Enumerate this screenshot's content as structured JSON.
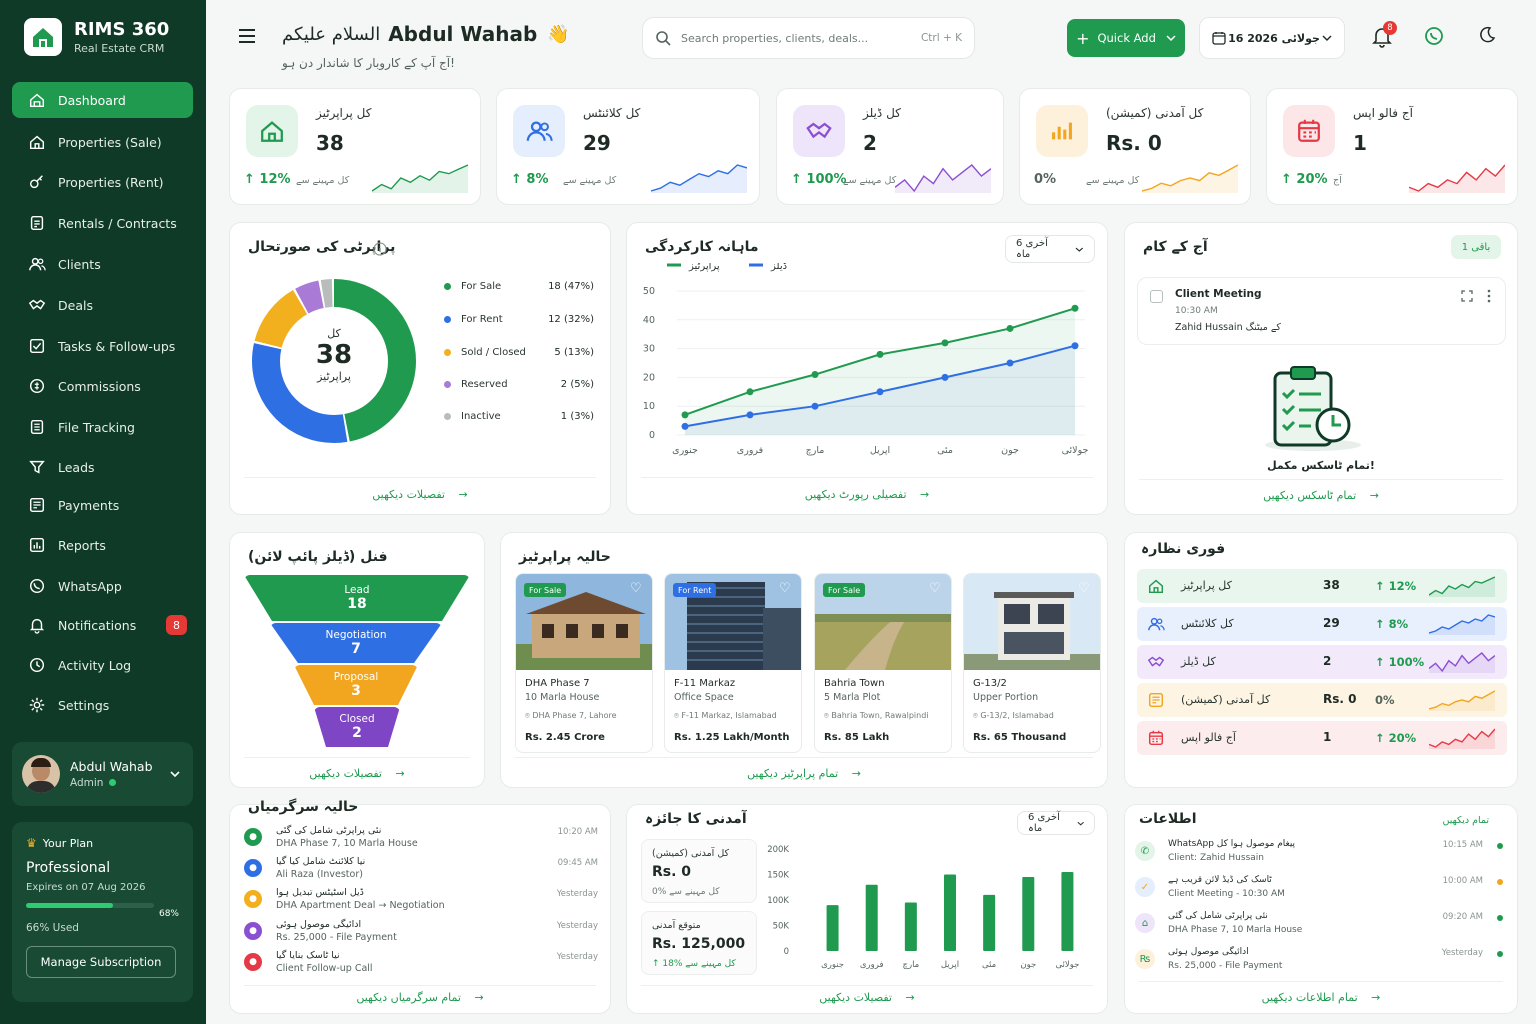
{
  "brand": {
    "name": "RIMS 360",
    "subtitle": "Real Estate CRM"
  },
  "nav": [
    {
      "label": "Dashboard",
      "icon": "dashboard-icon",
      "active": true
    },
    {
      "label": "Properties (Sale)",
      "icon": "home-icon"
    },
    {
      "label": "Properties (Rent)",
      "icon": "key-icon"
    },
    {
      "label": "Rentals / Contracts",
      "icon": "contract-icon"
    },
    {
      "label": "Clients",
      "icon": "users-icon"
    },
    {
      "label": "Deals",
      "icon": "handshake-icon"
    },
    {
      "label": "Tasks & Follow-ups",
      "icon": "checklist-icon"
    },
    {
      "label": "Commissions",
      "icon": "coin-icon"
    },
    {
      "label": "File Tracking",
      "icon": "file-icon"
    },
    {
      "label": "Leads",
      "icon": "funnel-icon"
    },
    {
      "label": "Payments",
      "icon": "payment-icon"
    },
    {
      "label": "Reports",
      "icon": "report-icon"
    },
    {
      "label": "WhatsApp",
      "icon": "whatsapp-icon"
    },
    {
      "label": "Notifications",
      "icon": "bell-icon",
      "badge": "8"
    },
    {
      "label": "Activity Log",
      "icon": "clock-icon"
    },
    {
      "label": "Settings",
      "icon": "gear-icon"
    }
  ],
  "user": {
    "name": "Abdul Wahab",
    "role": "Admin"
  },
  "plan": {
    "title": "Your Plan",
    "name": "Professional",
    "expires": "Expires on 07 Aug 2026",
    "percent_label": "68%",
    "used_fraction": 0.68,
    "used": "66% Used",
    "button": "Manage Subscription"
  },
  "header": {
    "salaam": "السلام علیکم",
    "name": "Abdul Wahab",
    "wave": "👋",
    "subtitle": "آج آپ کے کاروبار کا شاندار دن ہو!",
    "search_placeholder": "Search properties, clients, deals...",
    "search_shortcut": "Ctrl + K",
    "quick_add": "Quick Add",
    "date": "16 جولائی 2026",
    "bell_badge": "8"
  },
  "stats": [
    {
      "label": "کل پراپرٹیز",
      "value": "38",
      "trend": "↑ 12%",
      "sub": "کل مہینے سے",
      "color": "#1f9a4f",
      "bg": "#e3f4e9",
      "icon": "home-icon"
    },
    {
      "label": "کل کلائنٹس",
      "value": "29",
      "trend": "↑ 8%",
      "sub": "کل مہینے سے",
      "color": "#2f6fe4",
      "bg": "#e5eefc",
      "icon": "users-icon"
    },
    {
      "label": "کل ڈیلز",
      "value": "2",
      "trend": "↑ 100%",
      "sub": "کل مہینے سے",
      "color": "#8b4fd1",
      "bg": "#efe5fa",
      "icon": "handshake-icon"
    },
    {
      "label": "کل آمدنی (کمیشن)",
      "value": "Rs. 0",
      "trend": "0%",
      "sub": "کل مہینے سے",
      "color": "#f2a51e",
      "bg": "#fdf1dc",
      "icon": "chart-icon"
    },
    {
      "label": "آج فالو اپس",
      "value": "1",
      "trend": "↑ 20%",
      "sub": "آج",
      "color": "#e53945",
      "bg": "#fde6e8",
      "icon": "calendar-icon"
    }
  ],
  "status": {
    "title": "پراپرٹی کی صورتحال",
    "center_top": "کل",
    "center_value": "38",
    "center_bottom": "پراپرٹیز",
    "legend": [
      {
        "label": "For Sale",
        "value": "18 (47%)",
        "count": 18,
        "color": "#1f9a4f"
      },
      {
        "label": "For Rent",
        "value": "12 (32%)",
        "count": 12,
        "color": "#2f6fe4"
      },
      {
        "label": "Sold / Closed",
        "value": "5 (13%)",
        "count": 5,
        "color": "#f2b01e"
      },
      {
        "label": "Reserved",
        "value": "2 (5%)",
        "count": 2,
        "color": "#a97bd6"
      },
      {
        "label": "Inactive",
        "value": "1 (3%)",
        "count": 1,
        "color": "#b8bdbb"
      }
    ],
    "link": "تفصیلات دیکھیں"
  },
  "monthly": {
    "title": "ماہانہ کارکردگی",
    "filter": "آخری 6 ماہ",
    "link": "تفصیلی رپورٹ دیکھیں"
  },
  "chart_data": [
    {
      "type": "line",
      "title": "ماہانہ کارکردگی",
      "categories": [
        "جنوری",
        "فروری",
        "مارچ",
        "اپریل",
        "مئی",
        "جون",
        "جولائی"
      ],
      "ylim": [
        0,
        50
      ],
      "yticks": [
        "0",
        "10",
        "20",
        "30",
        "40",
        "50"
      ],
      "legend": "top-left",
      "series": [
        {
          "name": "پراپرٹیز",
          "values": [
            7,
            15,
            21,
            28,
            32,
            37,
            44
          ],
          "color": "#1f9a4f"
        },
        {
          "name": "ڈیلز",
          "values": [
            3,
            7,
            10,
            15,
            20,
            25,
            31
          ],
          "color": "#2f6fe4"
        }
      ]
    },
    {
      "type": "bar",
      "title": "آمدنی کا جائزہ",
      "categories": [
        "جنوری",
        "فروری",
        "مارچ",
        "اپریل",
        "مئی",
        "جون",
        "جولائی"
      ],
      "ylim": [
        0,
        200000
      ],
      "yticks": [
        "0",
        "50K",
        "100K",
        "150K",
        "200K"
      ],
      "values": [
        90000,
        130000,
        95000,
        150000,
        110000,
        145000,
        155000
      ],
      "color": "#1f9a4f"
    }
  ],
  "tasks": {
    "title": "آج کے کام",
    "badge": "1 باقی",
    "item_title": "Client Meeting",
    "item_time": "10:30 AM",
    "item_by": "Zahid Hussain کے میٹنگ",
    "done": "تمام ٹاسکس مکمل!",
    "link": "تمام ٹاسکس دیکھیں"
  },
  "funnel": {
    "title": "فنل (ڈیلز پائپ لائن)",
    "stages": [
      {
        "label": "Lead",
        "value": "18",
        "color": "#1f9a4f"
      },
      {
        "label": "Negotiation",
        "value": "7",
        "color": "#2f6fe4"
      },
      {
        "label": "Proposal",
        "value": "3",
        "color": "#f2a51e"
      },
      {
        "label": "Closed",
        "value": "2",
        "color": "#7e45c4"
      }
    ],
    "link": "تفصیلات دیکھیں"
  },
  "properties": {
    "title": "حالیہ پراپرٹیز",
    "items": [
      {
        "tag": "For Sale",
        "tag_color": "#1f9a4f",
        "name": "DHA Phase 7",
        "type": "10 Marla House",
        "loc": "DHA Phase 7, Lahore",
        "price": "Rs. 2.45 Crore"
      },
      {
        "tag": "For Rent",
        "tag_color": "#2f6fe4",
        "name": "F-11 Markaz",
        "type": "Office Space",
        "loc": "F-11 Markaz, Islamabad",
        "price": "Rs. 1.25 Lakh/Month"
      },
      {
        "tag": "For Sale",
        "tag_color": "#1f9a4f",
        "name": "Bahria Town",
        "type": "5 Marla Plot",
        "loc": "Bahria Town, Rawalpindi",
        "price": "Rs. 85 Lakh"
      },
      {
        "tag": "",
        "tag_color": "",
        "name": "G-13/2",
        "type": "Upper Portion",
        "loc": "G-13/2, Islamabad",
        "price": "Rs. 65 Thousand"
      }
    ],
    "link": "تمام پراپرٹیز دیکھیں"
  },
  "overview": {
    "title": "فوری نظارہ",
    "rows": [
      {
        "label": "کل پراپرٹیز",
        "value": "38",
        "trend": "↑ 12%",
        "bg": "#e8f6ee",
        "color": "#1f9a4f"
      },
      {
        "label": "کل کلائنٹس",
        "value": "29",
        "trend": "↑ 8%",
        "bg": "#e9f0fd",
        "color": "#2f6fe4"
      },
      {
        "label": "کل ڈیلز",
        "value": "2",
        "trend": "↑ 100%",
        "bg": "#f2eafb",
        "color": "#8b4fd1"
      },
      {
        "label": "کل آمدنی (کمیشن)",
        "value": "Rs. 0",
        "trend": "0%",
        "bg": "#fdf4e3",
        "color": "#f2a51e"
      },
      {
        "label": "آج فالو اپس",
        "value": "1",
        "trend": "↑ 20%",
        "bg": "#fdeced",
        "color": "#e53945"
      }
    ]
  },
  "activity": {
    "title": "حالیہ سرگرمیاں",
    "rows": [
      {
        "title": "نئی پراپرٹی شامل کی گئی",
        "sub": "DHA Phase 7, 10 Marla House",
        "time": "10:20 AM",
        "color": "#1f9a4f"
      },
      {
        "title": "نیا کلائنٹ شامل کیا گیا",
        "sub": "Ali Raza (Investor)",
        "time": "09:45 AM",
        "color": "#2f6fe4"
      },
      {
        "title": "ڈیل اسٹیٹس تبدیل ہوا",
        "sub": "DHA Apartment Deal → Negotiation",
        "time": "Yesterday",
        "color": "#f2b01e"
      },
      {
        "title": "ادائیگی موصول ہوئی",
        "sub": "Rs. 25,000 - File Payment",
        "time": "Yesterday",
        "color": "#8b4fd1"
      },
      {
        "title": "نیا ٹاسک بنایا گیا",
        "sub": "Client Follow-up Call",
        "time": "Yesterday",
        "color": "#e53945"
      }
    ],
    "link": "تمام سرگرمیاں دیکھیں"
  },
  "revenue": {
    "title": "آمدنی کا جائزہ",
    "filter": "آخری 6 ماہ",
    "total_label": "کل آمدنی (کمیشن)",
    "total_value": "Rs. 0",
    "total_sub": "0%  کل مہینے سے",
    "expected_label": "متوقع آمدنی",
    "expected_value": "Rs. 125,000",
    "expected_sub": "↑ 18%  کل مہینے سے",
    "link": "تفصیلات دیکھیں"
  },
  "notifications": {
    "title": "اطلاعات",
    "see_all": "تمام دیکھیں",
    "rows": [
      {
        "title": "WhatsApp پیغام موصول ہوا کل",
        "sub": "Client: Zahid Hussain",
        "time": "10:15 AM",
        "color": "#1f9a4f",
        "bg": "#e3f4e9"
      },
      {
        "title": "ٹاسک کی ڈیڈ لائن قریب ہے",
        "sub": "Client Meeting - 10:30 AM",
        "time": "10:00 AM",
        "color": "#f2a51e",
        "bg": "#e5eefc"
      },
      {
        "title": "نئی پراپرٹی شامل کی گئی",
        "sub": "DHA Phase 7, 10 Marla House",
        "time": "09:20 AM",
        "color": "#1f9a4f",
        "bg": "#efe5fa"
      },
      {
        "title": "ادائیگی موصول ہوئی",
        "sub": "Rs. 25,000 - File Payment",
        "time": "Yesterday",
        "color": "#1f9a4f",
        "bg": "#fdf1dc"
      }
    ],
    "link": "تمام اطلاعات دیکھیں"
  }
}
